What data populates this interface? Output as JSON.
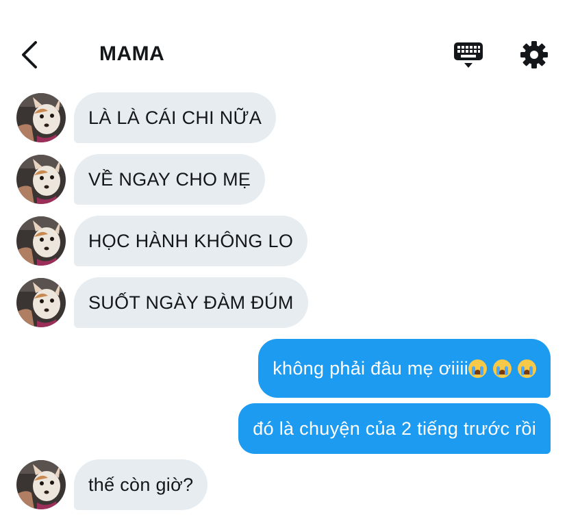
{
  "header": {
    "title": "MAMA",
    "back_icon": "chevron-left-icon",
    "keyboard_icon": "keyboard-icon",
    "settings_icon": "gear-icon"
  },
  "messages": [
    {
      "direction": "in",
      "text": "LÀ LÀ CÁI CHI NỮA"
    },
    {
      "direction": "in",
      "text": "VỀ NGAY CHO MẸ"
    },
    {
      "direction": "in",
      "text": "HỌC HÀNH KHÔNG LO"
    },
    {
      "direction": "in",
      "text": "SUỐT NGÀY ĐÀM ĐÚM"
    },
    {
      "direction": "out",
      "text": "không phải đâu mẹ ơiiii",
      "emoji": [
        "loudly-crying-face",
        "loudly-crying-face",
        "loudly-crying-face"
      ]
    },
    {
      "direction": "out",
      "text": "đó là chuyện của 2 tiếng trước rồi"
    },
    {
      "direction": "in",
      "text": "thế còn giờ?"
    }
  ],
  "colors": {
    "incoming_bubble": "#e7ecf0",
    "outgoing_bubble": "#1d9bf0",
    "text": "#14171a"
  },
  "avatar": "dog-photo-avatar"
}
